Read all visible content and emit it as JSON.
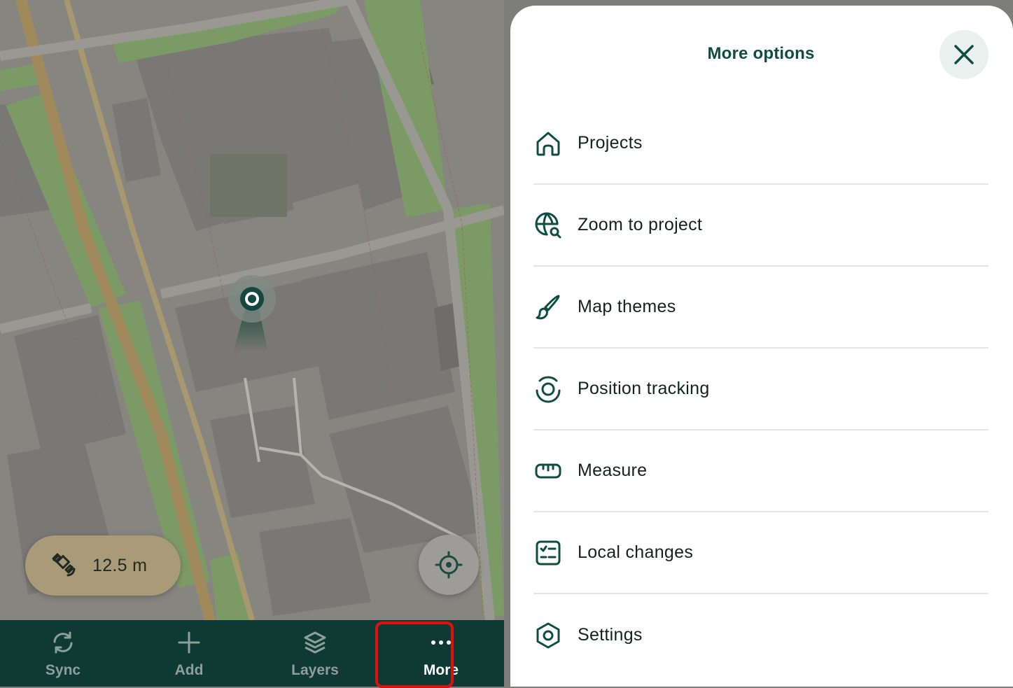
{
  "map": {
    "gps_accuracy": "12.5 m",
    "colors": {
      "park": "#7c9a66",
      "road_major": "#a08a5c",
      "building": "#7a7875"
    }
  },
  "bottom_bar": {
    "items": [
      {
        "label": "Sync",
        "icon": "sync-icon",
        "active": false
      },
      {
        "label": "Add",
        "icon": "plus-icon",
        "active": false
      },
      {
        "label": "Layers",
        "icon": "layers-icon",
        "active": false
      },
      {
        "label": "More",
        "icon": "more-dots-icon",
        "active": true
      }
    ]
  },
  "drawer": {
    "title": "More options",
    "close_icon": "close-icon",
    "items": [
      {
        "label": "Projects",
        "icon": "home-icon"
      },
      {
        "label": "Zoom to project",
        "icon": "globe-search-icon"
      },
      {
        "label": "Map themes",
        "icon": "brush-icon"
      },
      {
        "label": "Position tracking",
        "icon": "position-tracking-icon"
      },
      {
        "label": "Measure",
        "icon": "ruler-icon"
      },
      {
        "label": "Local changes",
        "icon": "checklist-icon"
      },
      {
        "label": "Settings",
        "icon": "settings-icon"
      }
    ]
  },
  "colors": {
    "accent": "#0f4d43",
    "bar_bg": "#0f3a34",
    "highlight": "#e01010"
  }
}
